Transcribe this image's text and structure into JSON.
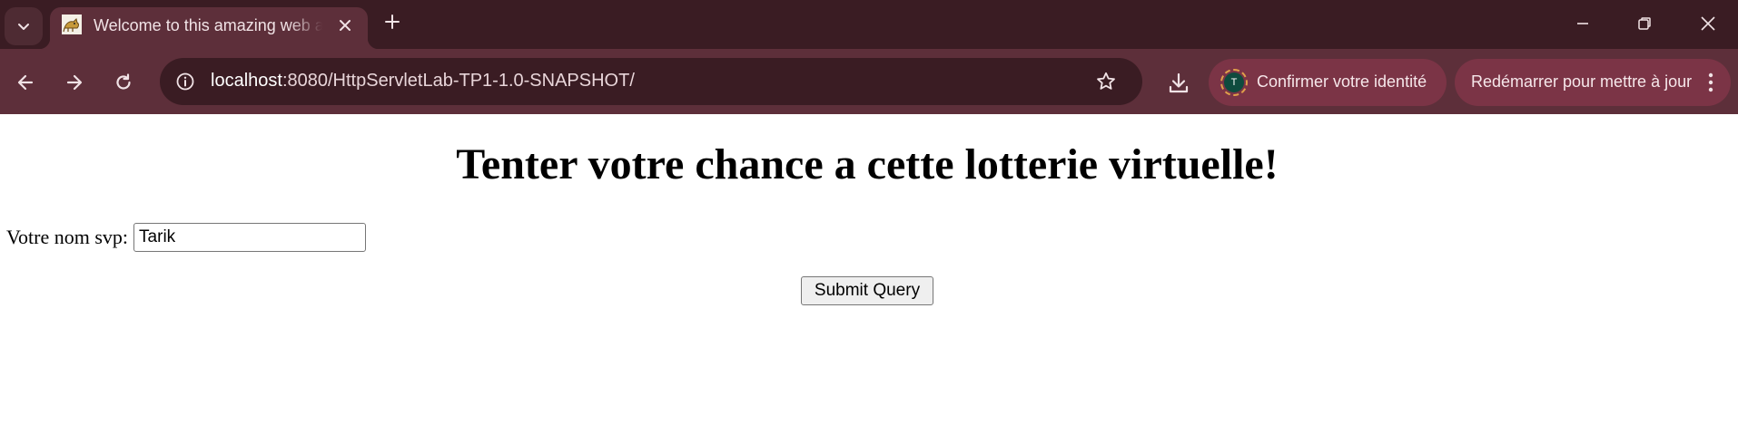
{
  "browser": {
    "tab": {
      "title": "Welcome to this amazing web app"
    },
    "address_bar": {
      "url_host": "localhost",
      "url_rest": ":8080/HttpServletLab-TP1-1.0-SNAPSHOT/"
    },
    "profile_button": {
      "avatar_initial": "T",
      "label": "Confirmer votre identité"
    },
    "restart_button": {
      "label": "Redémarrer pour mettre à jour"
    },
    "icons": {
      "tab_search": "chevron-down-icon",
      "tab_close": "close-icon",
      "new_tab": "plus-icon",
      "minimize": "minimize-icon",
      "restore": "restore-icon",
      "close_window": "close-icon",
      "back": "arrow-left-icon",
      "forward": "arrow-right-icon",
      "reload": "reload-icon",
      "site_info": "info-icon",
      "bookmark": "star-icon",
      "downloads": "download-icon",
      "menu": "kebab-icon"
    },
    "colors": {
      "tabstrip": "#3a1c23",
      "toolbar": "#5d2f3a",
      "pill": "#7b3446"
    }
  },
  "page": {
    "heading": "Tenter votre chance a cette lotterie virtuelle!",
    "name_label": "Votre nom svp:",
    "name_value": "Tarik",
    "submit_label": "Submit Query"
  }
}
